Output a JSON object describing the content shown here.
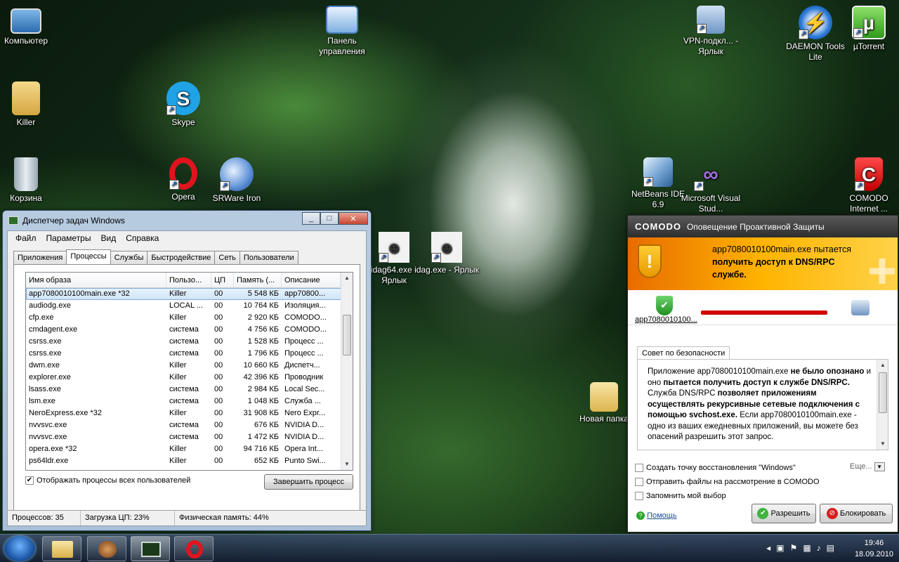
{
  "desktop": {
    "icons": [
      {
        "label": "Компьютер"
      },
      {
        "label": "Killer"
      },
      {
        "label": "Корзина"
      },
      {
        "label": "Skype"
      },
      {
        "label": "Opera"
      },
      {
        "label": "SRWare Iron"
      },
      {
        "label": "Панель управления"
      },
      {
        "label": "VPN-подкл... - Ярлык"
      },
      {
        "label": "DAEMON Tools Lite"
      },
      {
        "label": "µTorrent"
      },
      {
        "label": "NetBeans IDE 6.9"
      },
      {
        "label": "Microsoft Visual Stud..."
      },
      {
        "label": "COMODO Internet ..."
      },
      {
        "label": "idag64.exe - Ярлык"
      },
      {
        "label": "idag.exe - Ярлык"
      },
      {
        "label": "Новая папка"
      }
    ]
  },
  "task_manager": {
    "title": "Диспетчер задач Windows",
    "menu": [
      "Файл",
      "Параметры",
      "Вид",
      "Справка"
    ],
    "tabs": [
      "Приложения",
      "Процессы",
      "Службы",
      "Быстродействие",
      "Сеть",
      "Пользователи"
    ],
    "columns": [
      "Имя образа",
      "Пользо...",
      "ЦП",
      "Память (...",
      "Описание"
    ],
    "rows": [
      {
        "name": "app7080010100main.exe *32",
        "user": "Killer",
        "cpu": "00",
        "mem": "5 548 КБ",
        "desc": "app70800..."
      },
      {
        "name": "audiodg.exe",
        "user": "LOCAL ...",
        "cpu": "00",
        "mem": "10 764 КБ",
        "desc": "Изоляция..."
      },
      {
        "name": "cfp.exe",
        "user": "Killer",
        "cpu": "00",
        "mem": "2 920 КБ",
        "desc": "COMODO..."
      },
      {
        "name": "cmdagent.exe",
        "user": "система",
        "cpu": "00",
        "mem": "4 756 КБ",
        "desc": "COMODO..."
      },
      {
        "name": "csrss.exe",
        "user": "система",
        "cpu": "00",
        "mem": "1 528 КБ",
        "desc": "Процесс ..."
      },
      {
        "name": "csrss.exe",
        "user": "система",
        "cpu": "00",
        "mem": "1 796 КБ",
        "desc": "Процесс ..."
      },
      {
        "name": "dwm.exe",
        "user": "Killer",
        "cpu": "00",
        "mem": "10 660 КБ",
        "desc": "Диспетч..."
      },
      {
        "name": "explorer.exe",
        "user": "Killer",
        "cpu": "00",
        "mem": "42 396 КБ",
        "desc": "Проводник"
      },
      {
        "name": "lsass.exe",
        "user": "система",
        "cpu": "00",
        "mem": "2 984 КБ",
        "desc": "Local Sec..."
      },
      {
        "name": "lsm.exe",
        "user": "система",
        "cpu": "00",
        "mem": "1 048 КБ",
        "desc": "Служба ..."
      },
      {
        "name": "NeroExpress.exe *32",
        "user": "Killer",
        "cpu": "00",
        "mem": "31 908 КБ",
        "desc": "Nero Expr..."
      },
      {
        "name": "nvvsvc.exe",
        "user": "система",
        "cpu": "00",
        "mem": "676 КБ",
        "desc": "NVIDIA D..."
      },
      {
        "name": "nvvsvc.exe",
        "user": "система",
        "cpu": "00",
        "mem": "1 472 КБ",
        "desc": "NVIDIA D..."
      },
      {
        "name": "opera.exe *32",
        "user": "Killer",
        "cpu": "00",
        "mem": "94 716 КБ",
        "desc": "Opera Int..."
      },
      {
        "name": "ps64ldr.exe",
        "user": "Killer",
        "cpu": "00",
        "mem": "652 КБ",
        "desc": "Punto Swi..."
      }
    ],
    "show_all_label": "Отображать процессы всех пользователей",
    "show_all_checked": true,
    "end_process_label": "Завершить процесс",
    "status": {
      "processes": "Процессов: 35",
      "cpu": "Загрузка ЦП: 23%",
      "memory": "Физическая память: 44%"
    }
  },
  "comodo": {
    "brand": "COMODO",
    "title": "Оповещение Проактивной Защиты",
    "alert_line1": "app7080010100main.exe пытается",
    "alert_line2": "получить доступ к DNS/RPC",
    "alert_line3": "службе.",
    "app_label": "app7080010100...",
    "advice_tab": "Совет по безопасности",
    "advice": {
      "p1": "Приложение app7080010100main.exe ",
      "p1b": "не было опознано",
      "p2": " и оно ",
      "p2b": "пытается получить доступ к службе DNS/RPC.",
      "p3": " Служба DNS/RPC ",
      "p3b": "позволяет приложениям осуществлять рекурсивные сетевые подключения с помощью svchost.exe.",
      "p4": " Если app7080010100main.exe - одно из ваших ежедневных приложений, вы можете без опасений разрешить этот запрос."
    },
    "options": [
      "Создать точку восстановления \"Windows\"",
      "Отправить файлы на рассмотрение в COMODO",
      "Запомнить мой выбор"
    ],
    "more": "Еще...",
    "help": "Помощь",
    "allow": "Разрешить",
    "block": "Блокировать",
    "colors": {
      "alert": "#ffb400",
      "danger": "#d10000"
    }
  },
  "taskbar": {
    "time": "19:46",
    "date": "18.09.2010"
  }
}
